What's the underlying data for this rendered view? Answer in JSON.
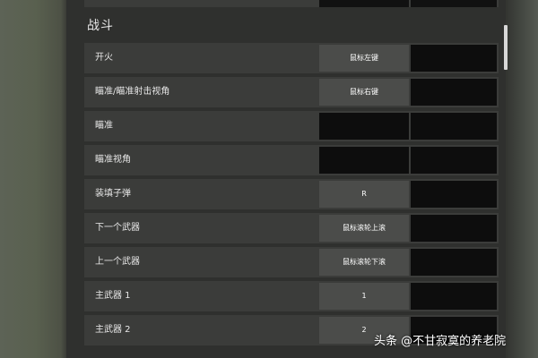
{
  "section": {
    "title": "战斗"
  },
  "bindings": [
    {
      "action": "开火",
      "primary": "鼠标左键",
      "secondary": ""
    },
    {
      "action": "瞄准/瞄准射击视角",
      "primary": "鼠标右键",
      "secondary": ""
    },
    {
      "action": "瞄准",
      "primary": "",
      "secondary": ""
    },
    {
      "action": "瞄准视角",
      "primary": "",
      "secondary": ""
    },
    {
      "action": "装填子弹",
      "primary": "R",
      "secondary": ""
    },
    {
      "action": "下一个武器",
      "primary": "鼠标滚轮上滚",
      "secondary": ""
    },
    {
      "action": "上一个武器",
      "primary": "鼠标滚轮下滚",
      "secondary": ""
    },
    {
      "action": "主武器 1",
      "primary": "1",
      "secondary": ""
    },
    {
      "action": "主武器 2",
      "primary": "2",
      "secondary": ""
    }
  ],
  "watermark": {
    "text": "头条 @不甘寂寞的养老院"
  },
  "colors": {
    "row_background": "#3b3c3a",
    "assigned_key_background": "#4b4c4a",
    "empty_key_background": "#0d0d0d",
    "panel_background": "#2f302e"
  }
}
